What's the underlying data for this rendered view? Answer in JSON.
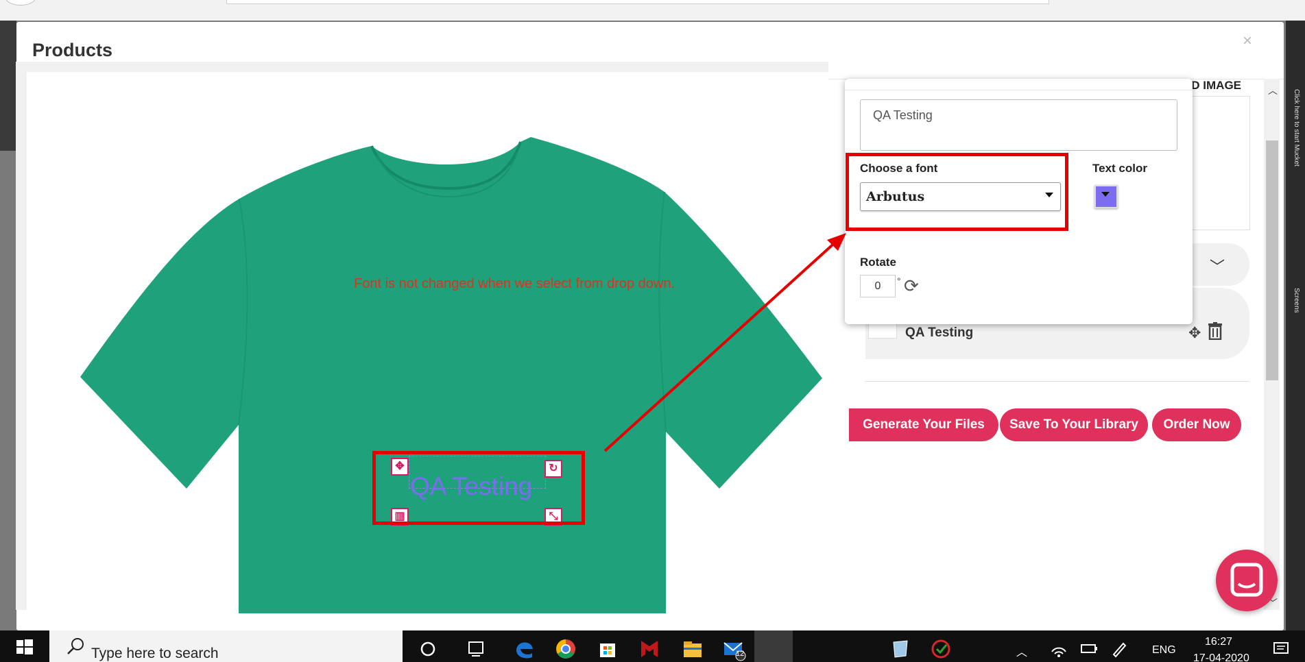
{
  "modal": {
    "title": "Products",
    "close_label": "×"
  },
  "annotation": "Font is not changed when we select from drop down.",
  "design": {
    "text": "QA Testing"
  },
  "panel": {
    "upload_label": "AD IMAGE",
    "text_value": "QA Testing",
    "font_label": "Choose a font",
    "font_value": "Arbutus",
    "text_color_label": "Text color",
    "text_color": "#7b6cf0",
    "rotate_label": "Rotate",
    "rotate_value": "0",
    "rotate_unit": "°"
  },
  "layers": [
    {
      "index": "1",
      "name": "QA Testing"
    }
  ],
  "buttons": {
    "generate": "Generate Your Files",
    "save": "Save To Your Library",
    "order": "Order Now"
  },
  "shirt_color": "#1fa27c",
  "accent_color": "#e0315c",
  "highlight_color": "#e60000",
  "taskbar": {
    "search_placeholder": "Type here to search",
    "language": "ENG",
    "time": "16:27",
    "date": "17-04-2020",
    "mail_badge": "12"
  },
  "side_text": "Click here to start Mucket",
  "side_text_2": "Screens"
}
